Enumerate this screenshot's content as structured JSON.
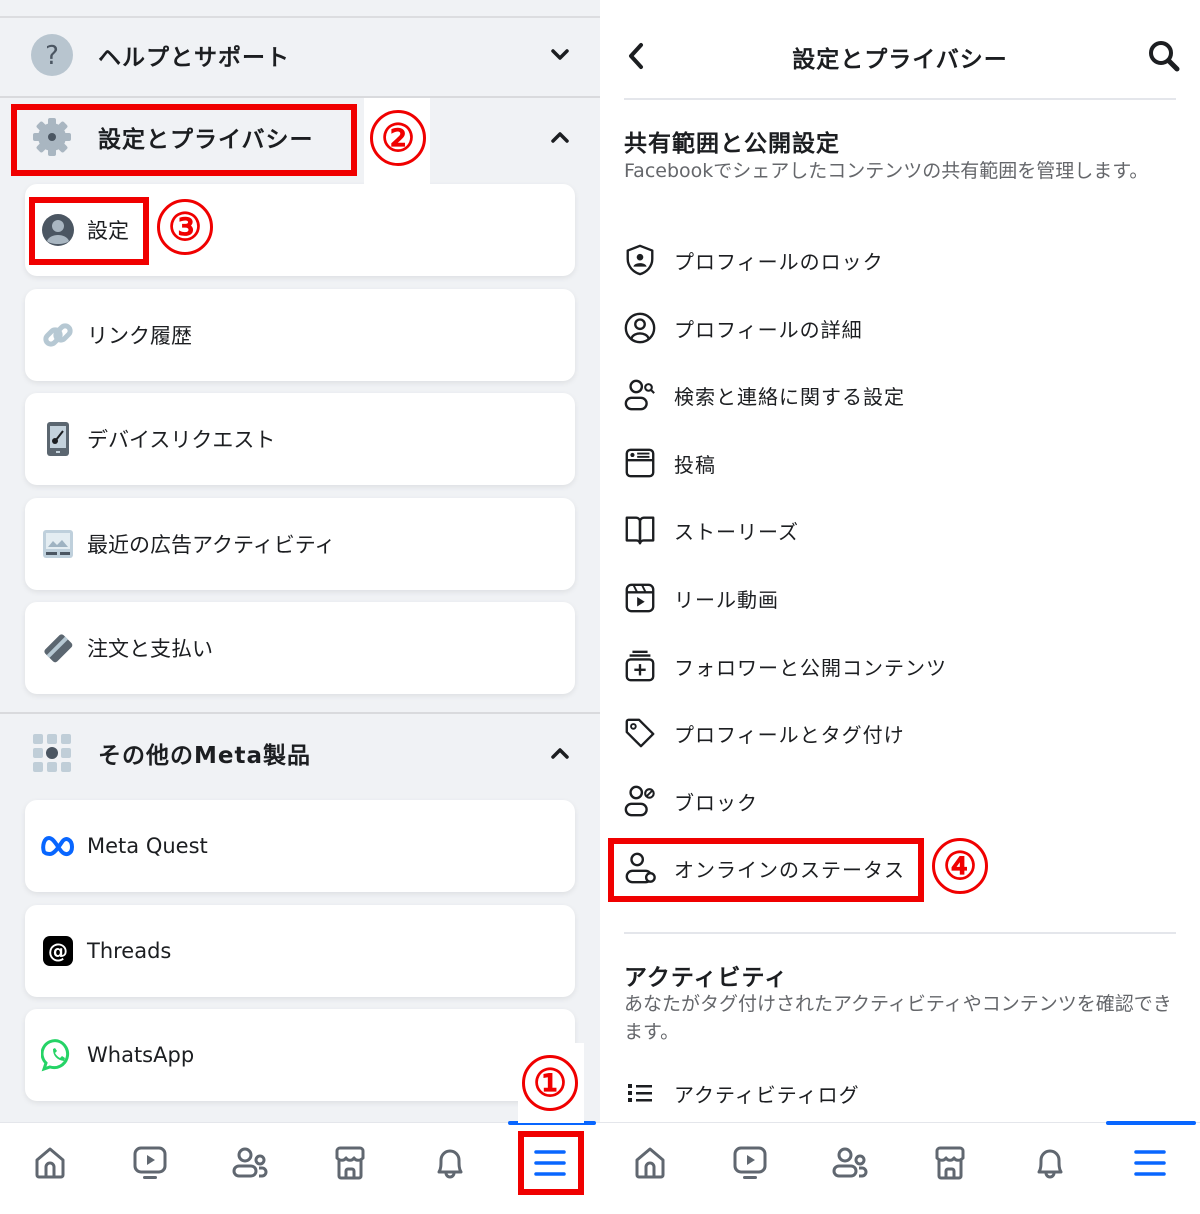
{
  "left": {
    "help_section": {
      "label": "ヘルプとサポート",
      "icon": "question-icon",
      "expanded": false
    },
    "settings_section": {
      "label": "設定とプライバシー",
      "icon": "gear-icon",
      "expanded": true,
      "items": [
        {
          "label": "設定",
          "icon": "profile-icon"
        },
        {
          "label": "リンク履歴",
          "icon": "link-icon"
        },
        {
          "label": "デバイスリクエスト",
          "icon": "device-key-icon"
        },
        {
          "label": "最近の広告アクティビティ",
          "icon": "ad-activity-icon"
        },
        {
          "label": "注文と支払い",
          "icon": "card-icon"
        }
      ]
    },
    "meta_section": {
      "label": "その他のMeta製品",
      "icon": "grid-icon",
      "expanded": true,
      "items": [
        {
          "label": "Meta Quest",
          "icon": "meta-logo-icon"
        },
        {
          "label": "Threads",
          "icon": "threads-logo-icon"
        },
        {
          "label": "WhatsApp",
          "icon": "whatsapp-logo-icon"
        }
      ]
    },
    "annotations": {
      "step1": "①",
      "step2": "②",
      "step3": "③"
    }
  },
  "right": {
    "header": {
      "title": "設定とプライバシー",
      "back": "back-icon",
      "search": "search-icon"
    },
    "sharing_section": {
      "title": "共有範囲と公開設定",
      "description": "Facebookでシェアしたコンテンツの共有範囲を管理します。",
      "items": [
        {
          "label": "プロフィールのロック",
          "icon": "shield-profile-icon"
        },
        {
          "label": "プロフィールの詳細",
          "icon": "profile-circle-icon"
        },
        {
          "label": "検索と連絡に関する設定",
          "icon": "person-search-icon"
        },
        {
          "label": "投稿",
          "icon": "post-icon"
        },
        {
          "label": "ストーリーズ",
          "icon": "book-icon"
        },
        {
          "label": "リール動画",
          "icon": "reels-icon"
        },
        {
          "label": "フォロワーと公開コンテンツ",
          "icon": "followers-icon"
        },
        {
          "label": "プロフィールとタグ付け",
          "icon": "tag-icon"
        },
        {
          "label": "ブロック",
          "icon": "block-person-icon"
        },
        {
          "label": "オンラインのステータス",
          "icon": "online-status-icon"
        }
      ]
    },
    "activity_section": {
      "title": "アクティビティ",
      "description": "あなたがタグ付けされたアクティビティやコンテンツを確認できます。",
      "items": [
        {
          "label": "アクティビティログ",
          "icon": "list-icon"
        }
      ]
    },
    "annotations": {
      "step4": "④"
    }
  },
  "bottom_nav": {
    "items": [
      {
        "name": "home",
        "icon": "home-icon"
      },
      {
        "name": "video",
        "icon": "video-icon"
      },
      {
        "name": "friends",
        "icon": "friends-icon"
      },
      {
        "name": "marketplace",
        "icon": "marketplace-icon"
      },
      {
        "name": "notifications",
        "icon": "bell-icon"
      },
      {
        "name": "menu",
        "icon": "menu-icon",
        "active": true
      }
    ]
  },
  "colors": {
    "accent": "#0866ff",
    "annotation": "#f00000",
    "background_left": "#f0f2f5",
    "text_secondary": "#65676b"
  }
}
